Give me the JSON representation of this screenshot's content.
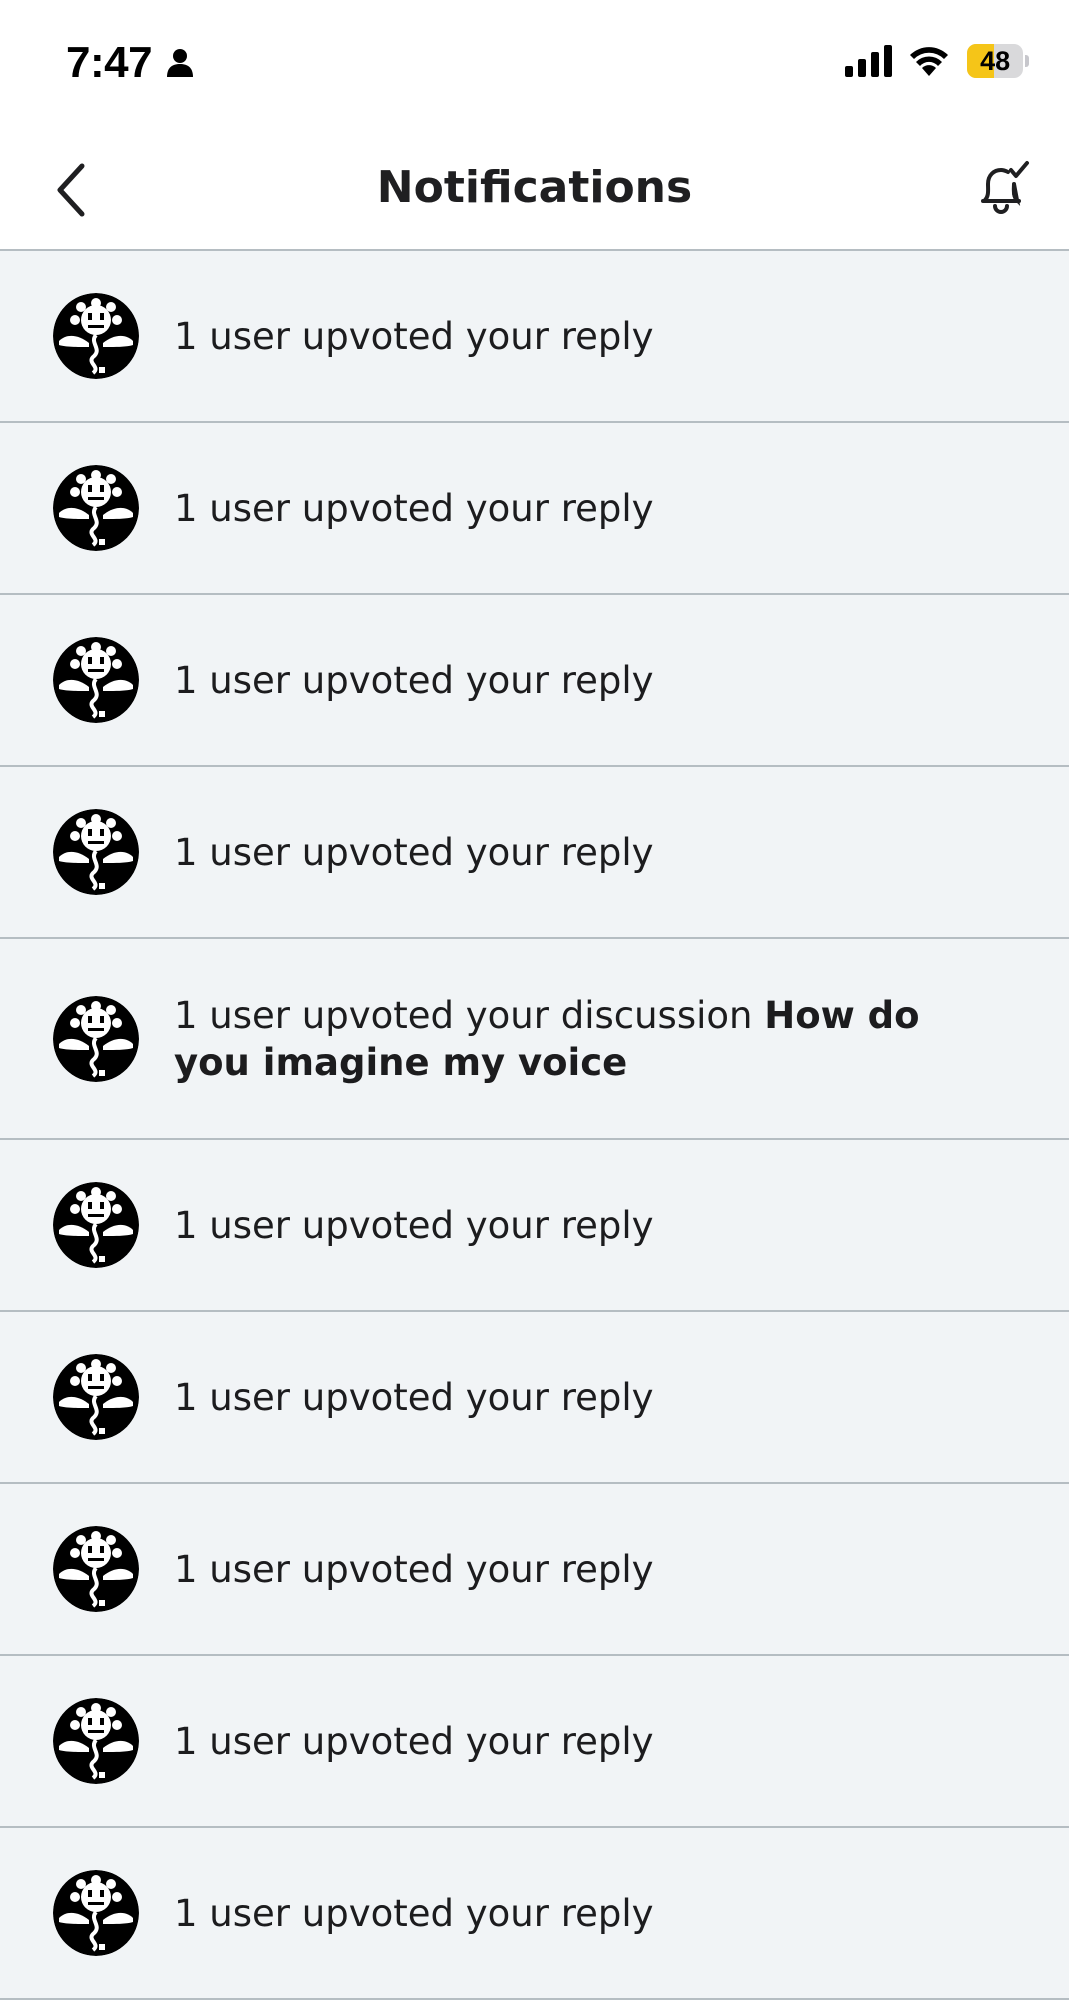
{
  "status_bar": {
    "time": "7:47",
    "battery_level": "48",
    "icons": [
      "person-icon",
      "cellular-signal-icon",
      "wifi-icon",
      "battery-icon"
    ]
  },
  "header": {
    "title": "Notifications",
    "back_icon": "chevron-left-icon",
    "action_icon": "bell-check-icon"
  },
  "colors": {
    "row_background": "#f1f4f6",
    "divider": "#b5bdc2",
    "battery_fill": "#f5c518"
  },
  "notifications": [
    {
      "text": "1 user upvoted your reply",
      "bold": ""
    },
    {
      "text": "1 user upvoted your reply",
      "bold": ""
    },
    {
      "text": "1 user upvoted your reply",
      "bold": ""
    },
    {
      "text": "1 user upvoted your reply",
      "bold": ""
    },
    {
      "text": "1 user upvoted your discussion",
      "bold": "How do you imagine my voice"
    },
    {
      "text": "1 user upvoted your reply",
      "bold": ""
    },
    {
      "text": "1 user upvoted your reply",
      "bold": ""
    },
    {
      "text": "1 user upvoted your reply",
      "bold": ""
    },
    {
      "text": "1 user upvoted your reply",
      "bold": ""
    },
    {
      "text": "1 user upvoted your reply",
      "bold": ""
    }
  ]
}
